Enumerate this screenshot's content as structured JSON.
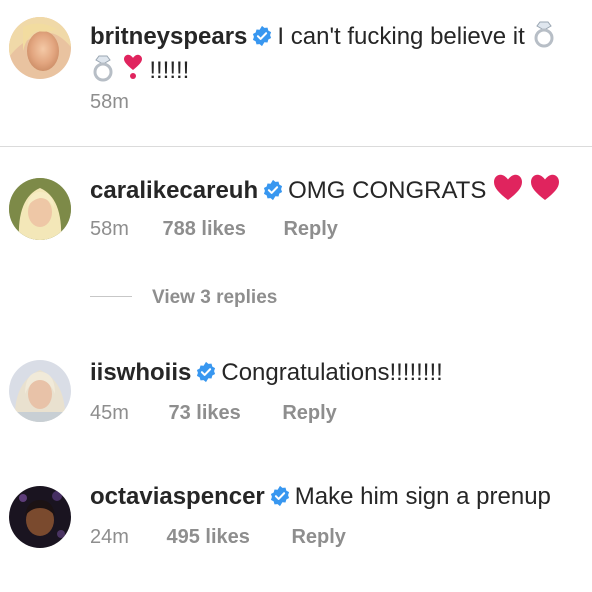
{
  "comments": [
    {
      "username": "britneyspears",
      "verified": true,
      "text": "I can't fucking believe it",
      "text2": "!!!!!!",
      "time": "58m"
    },
    {
      "username": "caralikecareuh",
      "verified": true,
      "text": "OMG CONGRATS",
      "time": "58m",
      "likes": "788 likes",
      "reply": "Reply"
    },
    {
      "username": "iiswhoiis",
      "verified": true,
      "text": "Congratulations!!!!!!!!",
      "time": "45m",
      "likes": "73 likes",
      "reply": "Reply"
    },
    {
      "username": "octaviaspencer",
      "verified": true,
      "text": "Make him sign a prenup",
      "time": "24m",
      "likes": "495 likes",
      "reply": "Reply"
    }
  ],
  "view_replies": "View 3 replies",
  "colors": {
    "username": "#262626",
    "meta": "#8e8e8e",
    "verified": "#3897f0",
    "heart": "#e0245e"
  },
  "icons": [
    "verified-badge-icon",
    "ring-icon",
    "heart-exclamation-icon",
    "red-heart-icon"
  ]
}
